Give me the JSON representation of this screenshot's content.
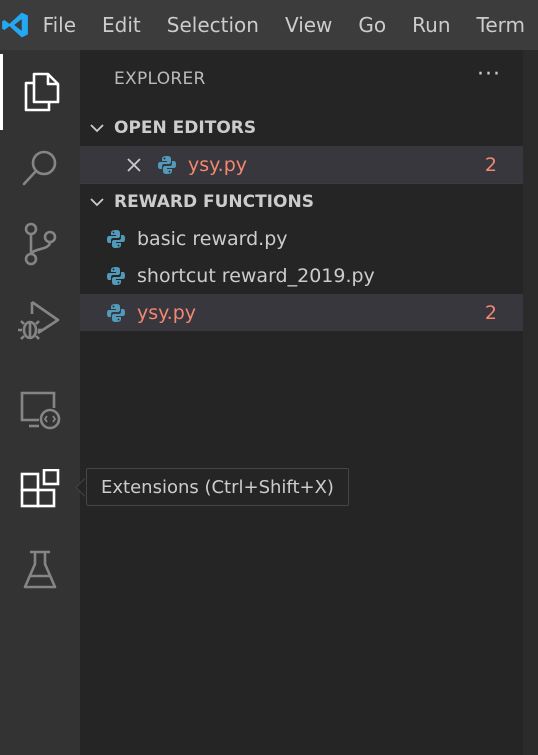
{
  "titlebar": {
    "logo_icon": "vscode-logo-icon",
    "menu": [
      "File",
      "Edit",
      "Selection",
      "View",
      "Go",
      "Run",
      "Term"
    ]
  },
  "activity_bar": {
    "items": [
      {
        "icon": "files-icon",
        "active": true
      },
      {
        "icon": "search-icon"
      },
      {
        "icon": "source-control-icon"
      },
      {
        "icon": "run-debug-icon"
      },
      {
        "icon": "remote-explorer-icon"
      },
      {
        "icon": "extensions-icon"
      },
      {
        "icon": "testing-flask-icon"
      }
    ]
  },
  "sidebar": {
    "title": "EXPLORER",
    "more_label": "···",
    "open_editors": {
      "label": "OPEN EDITORS",
      "files": [
        {
          "name": "ysy.py",
          "badge": "2"
        }
      ]
    },
    "workspace": {
      "label": "REWARD FUNCTIONS",
      "files": [
        {
          "name": "basic reward.py"
        },
        {
          "name": "shortcut reward_2019.py"
        },
        {
          "name": "ysy.py",
          "badge": "2"
        }
      ]
    }
  },
  "tooltip": {
    "text": "Extensions (Ctrl+Shift+X)"
  },
  "colors": {
    "error": "#f48771",
    "python_blue": "#519aba",
    "vscode_blue": "#23a9f2"
  }
}
